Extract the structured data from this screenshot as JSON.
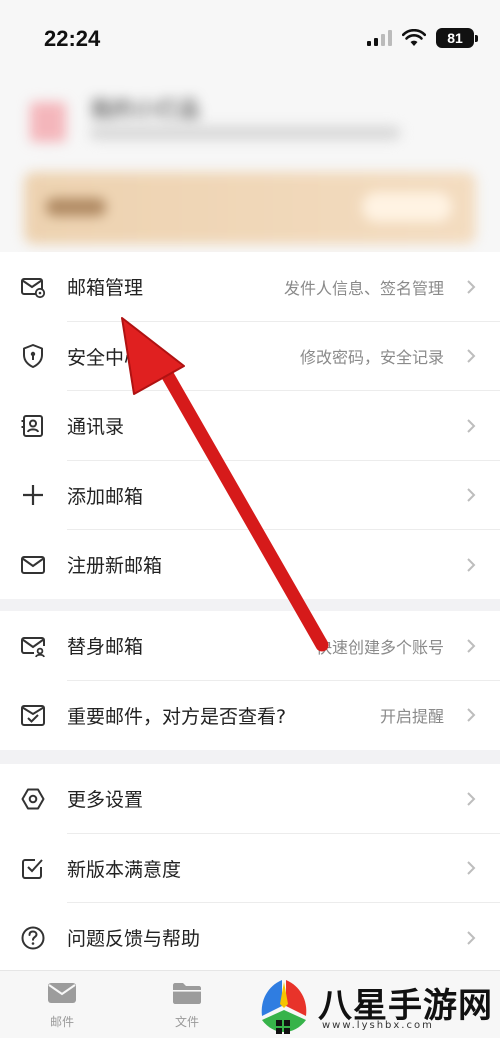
{
  "status_bar": {
    "time": "22:24",
    "battery": "81"
  },
  "profile": {
    "name": "我的小灯品"
  },
  "groups": [
    {
      "items": [
        {
          "label": "邮箱管理",
          "value": "发件人信息、签名管理",
          "icon": "mailbox-settings-icon"
        },
        {
          "label": "安全中心",
          "value": "修改密码，安全记录",
          "icon": "shield-icon"
        },
        {
          "label": "通讯录",
          "value": "",
          "icon": "contacts-icon"
        },
        {
          "label": "添加邮箱",
          "value": "",
          "icon": "plus-icon"
        },
        {
          "label": "注册新邮箱",
          "value": "",
          "icon": "mail-icon"
        }
      ]
    },
    {
      "items": [
        {
          "label": "替身邮箱",
          "value": "快速创建多个账号",
          "icon": "alias-mail-icon"
        },
        {
          "label": "重要邮件，对方是否查看?",
          "value": "开启提醒",
          "icon": "read-receipt-icon"
        }
      ]
    },
    {
      "items": [
        {
          "label": "更多设置",
          "value": "",
          "icon": "settings-hexagon-icon"
        },
        {
          "label": "新版本满意度",
          "value": "",
          "icon": "checkbox-icon"
        },
        {
          "label": "问题反馈与帮助",
          "value": "",
          "icon": "help-icon"
        }
      ]
    }
  ],
  "tabbar": {
    "tabs": [
      {
        "label": "邮件"
      },
      {
        "label": "文件"
      }
    ]
  },
  "watermark": {
    "text": "八星手游网",
    "url": "www.lyshbx.com"
  },
  "colors": {
    "accent_arrow": "#e02020",
    "icon": "#333333",
    "muted": "#8a8a8a"
  }
}
